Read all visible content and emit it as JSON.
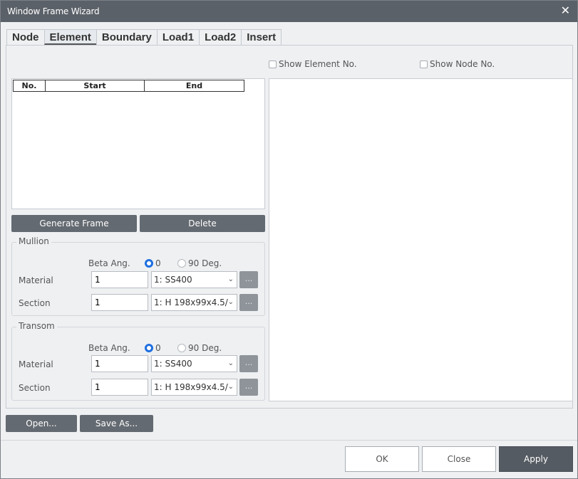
{
  "window": {
    "title": "Window Frame Wizard",
    "close_glyph": "✕"
  },
  "tabs": [
    {
      "label": "Node"
    },
    {
      "label": "Element"
    },
    {
      "label": "Boundary"
    },
    {
      "label": "Load1"
    },
    {
      "label": "Load2"
    },
    {
      "label": "Insert"
    }
  ],
  "active_tab": "Element",
  "options": {
    "show_element_no": {
      "label": "Show Element No.",
      "checked": false
    },
    "show_node_no": {
      "label": "Show Node No.",
      "checked": false
    }
  },
  "grid": {
    "columns": [
      "No.",
      "Start",
      "End"
    ],
    "rows": []
  },
  "actions": {
    "generate": "Generate Frame",
    "delete": "Delete"
  },
  "mullion": {
    "legend": "Mullion",
    "beta_label": "Beta Ang.",
    "beta_options": [
      "0",
      "90 Deg."
    ],
    "beta_selected": "0",
    "material_label": "Material",
    "material_value": "1",
    "material_select": "1: SS400",
    "section_label": "Section",
    "section_value": "1",
    "section_select": "1: H 198x99x4.5/",
    "ellipsis": "..."
  },
  "transom": {
    "legend": "Transom",
    "beta_label": "Beta Ang.",
    "beta_options": [
      "0",
      "90 Deg."
    ],
    "beta_selected": "0",
    "material_label": "Material",
    "material_value": "1",
    "material_select": "1: SS400",
    "section_label": "Section",
    "section_value": "1",
    "section_select": "1: H 198x99x4.5/",
    "ellipsis": "..."
  },
  "file": {
    "open": "Open...",
    "save_as": "Save As..."
  },
  "footer": {
    "ok": "OK",
    "close": "Close",
    "apply": "Apply"
  },
  "colors": {
    "titlebar": "#5b6168",
    "dark_button": "#646a71",
    "radio_accent": "#1f6fe0",
    "apply": "#555b62"
  },
  "icons": {
    "close": "close-icon",
    "dropdown": "chevron-down-icon"
  }
}
